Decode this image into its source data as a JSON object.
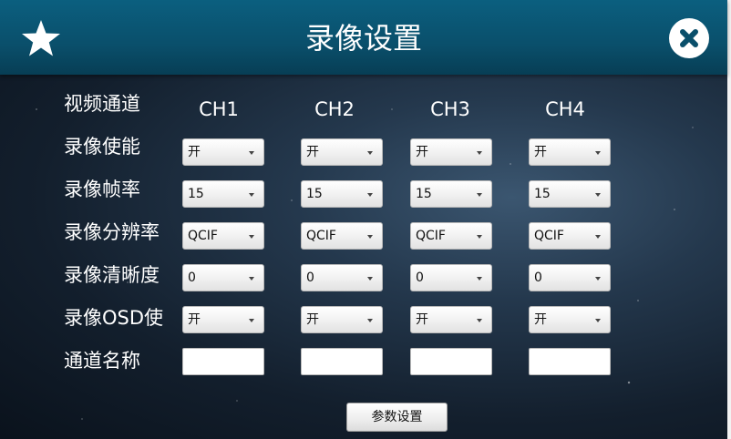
{
  "window": {
    "title": "录像设置",
    "star_icon": "star-icon",
    "close_icon": "close-icon"
  },
  "labels": [
    "视频通道",
    "录像使能",
    "录像帧率",
    "录像分辨率",
    "录像清晰度",
    "录像OSD使",
    "通道名称"
  ],
  "channels": [
    {
      "name": "CH1",
      "enable": "开",
      "fps": "15",
      "resolution": "QCIF",
      "clarity": "0",
      "osd": "开",
      "channel_name": ""
    },
    {
      "name": "CH2",
      "enable": "开",
      "fps": "15",
      "resolution": "QCIF",
      "clarity": "0",
      "osd": "开",
      "channel_name": ""
    },
    {
      "name": "CH3",
      "enable": "开",
      "fps": "15",
      "resolution": "QCIF",
      "clarity": "0",
      "osd": "开",
      "channel_name": ""
    },
    {
      "name": "CH4",
      "enable": "开",
      "fps": "15",
      "resolution": "QCIF",
      "clarity": "0",
      "osd": "开",
      "channel_name": ""
    }
  ],
  "footer": {
    "apply_label": "参数设置"
  },
  "colors": {
    "titlebar": "#0a4f6b",
    "text": "#ffffff"
  }
}
